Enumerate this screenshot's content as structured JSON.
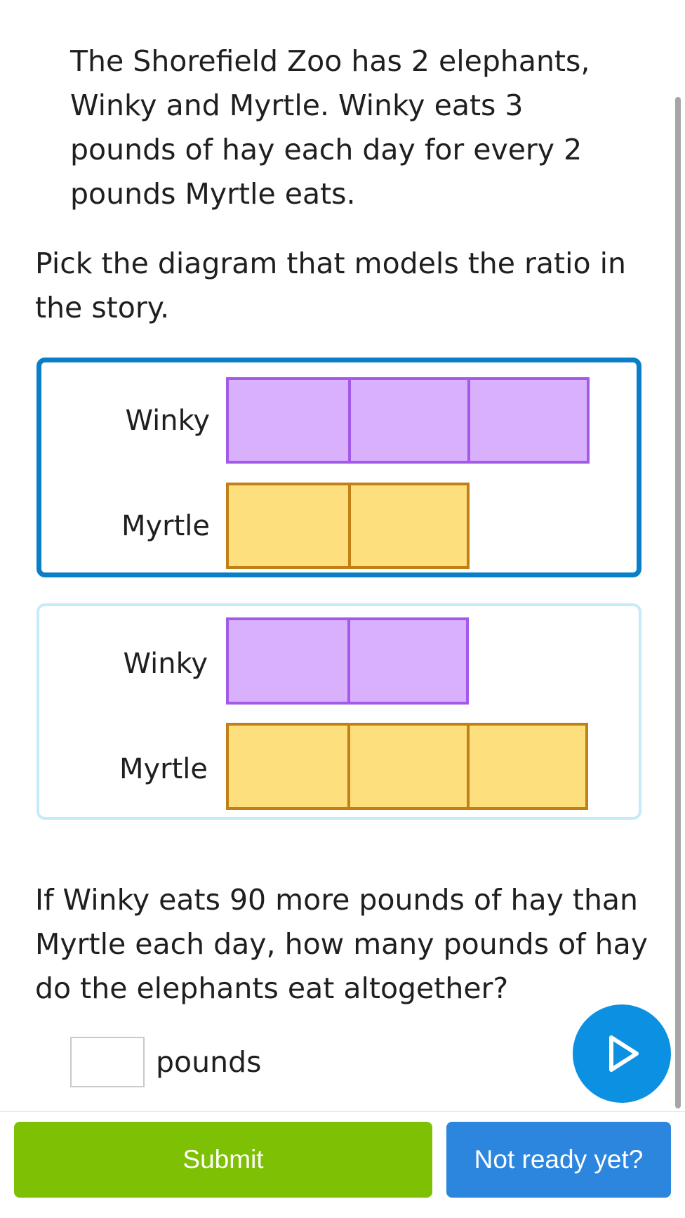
{
  "story": "The Shorefield Zoo has 2 elephants, Winky and Myrtle. Winky eats 3 pounds of hay each day for every 2 pounds Myrtle eats.",
  "prompt": "Pick the diagram that models the ratio in the story.",
  "options": [
    {
      "selected": true,
      "rows": [
        {
          "label": "Winky",
          "units": 3,
          "color": "purple"
        },
        {
          "label": "Myrtle",
          "units": 2,
          "color": "yellow"
        }
      ]
    },
    {
      "selected": false,
      "rows": [
        {
          "label": "Winky",
          "units": 2,
          "color": "purple"
        },
        {
          "label": "Myrtle",
          "units": 3,
          "color": "yellow"
        }
      ]
    }
  ],
  "question": "If Winky eats 90 more pounds of hay than Myrtle each day, how many pounds of hay do the elephants eat altogether?",
  "answer": {
    "value": "",
    "unit": "pounds"
  },
  "buttons": {
    "submit": "Submit",
    "not_ready": "Not ready yet?"
  },
  "colors": {
    "selected_border": "#0a7fc8",
    "unselected_border": "#c4ecf8",
    "purple_fill": "#d9b0fc",
    "purple_border": "#a35ae8",
    "yellow_fill": "#fedf7e",
    "yellow_border": "#c27f16",
    "submit": "#7ec003",
    "not_ready": "#2d86dd",
    "play": "#0b90e2"
  },
  "icons": {
    "audio": "play-icon"
  }
}
